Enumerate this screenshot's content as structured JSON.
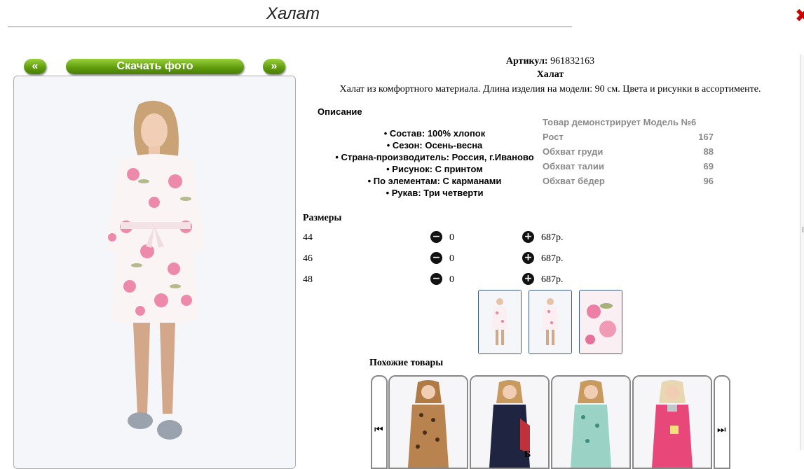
{
  "window": {
    "title": "Халат",
    "close_icon": "close-x-icon"
  },
  "gallery": {
    "prev_label": "«",
    "download_label": "Скачать фото",
    "next_label": "»"
  },
  "product": {
    "article_label": "Артикул:",
    "article_value": "961832163",
    "name": "Халат",
    "description": "Халат из комфортного материала. Длина изделия на модели: 90 см. Цвета и рисунки в ассортименте."
  },
  "details": {
    "heading": "Описание",
    "properties": [
      "• Состав: 100% хлопок",
      "• Сезон: Осень-весна",
      "• Страна-производитель: Россия, г.Иваново",
      "• Рисунок: С принтом",
      "• По элементам: С карманами",
      "• Рукав: Три четверти"
    ]
  },
  "model": {
    "heading": "Товар демонстрирует Модель №6",
    "rows": [
      {
        "label": "Рост",
        "value": "167"
      },
      {
        "label": "Обхват груди",
        "value": "88"
      },
      {
        "label": "Обхват талии",
        "value": "69"
      },
      {
        "label": "Обхват бёдер",
        "value": "96"
      }
    ]
  },
  "sizes": {
    "heading": "Размеры",
    "rows": [
      {
        "size": "44",
        "qty": "0",
        "price": "687р."
      },
      {
        "size": "46",
        "qty": "0",
        "price": "687р."
      },
      {
        "size": "48",
        "qty": "0",
        "price": "687р."
      }
    ],
    "minus_icon": "minus-circle-icon",
    "plus_icon": "plus-circle-icon"
  },
  "similar": {
    "heading": "Похожие товары",
    "prev_icon": "skip-back-icon",
    "next_icon": "skip-forward-icon",
    "prev_glyph": "⏮",
    "next_glyph": "⏭"
  },
  "bottom_cut_text": "Б",
  "colors": {
    "button_green": "#5e9a0d",
    "close_red": "#cc0000",
    "model_gray": "#8a8a8a",
    "thumb_border": "#3a5a8a"
  }
}
